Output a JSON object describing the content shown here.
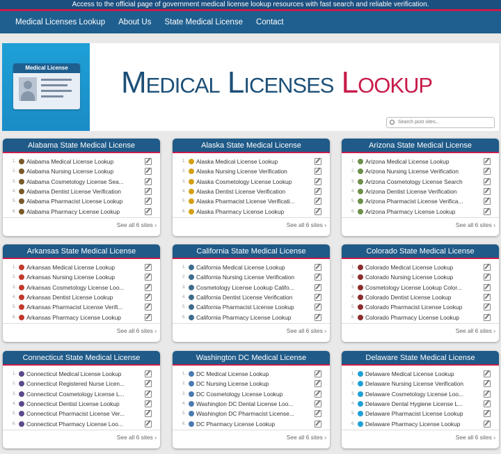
{
  "banner": {
    "text": "Access to the official page of government medical license lookup resources with fast search and reliable verification."
  },
  "nav": [
    "Medical Licenses Lookup",
    "About Us",
    "State Medical License",
    "Contact"
  ],
  "hero": {
    "card_label": "Medical License",
    "title_main": "Medical Licenses ",
    "title_accent": "Lookup",
    "search_placeholder": "Search post sites..."
  },
  "colors": {
    "brand": "#1e5f8f",
    "accent": "#c81b4a",
    "hero_blue": "#1ea0d6"
  },
  "panels": [
    {
      "title": "Alabama State Medical License",
      "icon": "#7a5a2a",
      "more": "See all 6 sites ›",
      "items": [
        "Alabama Medical License Lookup",
        "Alabama Nursing License Lookup",
        "Alabama Cosmetology License Sea...",
        "Alabama Dentist License Verification",
        "Alabama Pharmacist License Lookup",
        "Alabama Pharmacy License Lookup"
      ]
    },
    {
      "title": "Alaska State Medical License",
      "icon": "#d4a017",
      "more": "See all 6 sites ›",
      "items": [
        "Alaska Medical License Lookup",
        "Alaska Nursing License Verification",
        "Alaska Cosmetology License Lookup",
        "Alaska Dentist License Verification",
        "Alaska Pharmacist License Verificati...",
        "Alaska Pharmacy License Lookup"
      ]
    },
    {
      "title": "Arizona State Medical License",
      "icon": "#6d8f4a",
      "more": "See all 6 sites ›",
      "items": [
        "Arizona Medical License Lookup",
        "Arizona Nursing License Verification",
        "Arizona Cosmetology License Search",
        "Arizona Dentist License Verification",
        "Arizona Pharmacist License Verifica...",
        "Arizona Pharmacy License Lookup"
      ]
    },
    {
      "title": "Arkansas State Medical License",
      "icon": "#c0392b",
      "more": "See all 6 sites ›",
      "items": [
        "Arkansas Medical License Lookup",
        "Arkansas Nursing License Lookup",
        "Arkansas Cosmetology License Loo...",
        "Arkansas Dentist License Lookup",
        "Arkansas Pharmacist License Verifi...",
        "Arkansas Pharmacy License Lookup"
      ]
    },
    {
      "title": "California State Medical License",
      "icon": "#3d6b8c",
      "more": "See all 6 sites ›",
      "items": [
        "California Medical License Lookup",
        "California Nursing License Verification",
        "Cosmetology License Lookup Califo...",
        "California Dentist License Verification",
        "California Pharmacist License Lookup",
        "California Pharmacy License Lookup"
      ]
    },
    {
      "title": "Colorado State Medical License",
      "icon": "#8c2d2d",
      "more": "See all 6 sites ›",
      "items": [
        "Colorado Medical License Lookup",
        "Colorado Nursing License Lookup",
        "Cosmetology License Lookup Color...",
        "Colorado Dentist License Lookup",
        "Colorado Pharmacist License Lookup",
        "Colorado Pharmacy License Lookup"
      ]
    },
    {
      "title": "Connecticut State Medical License",
      "icon": "#5b4a8c",
      "more": "See all 6 sites ›",
      "items": [
        "Connecticut Medical License Lookup",
        "Connecticut Registered Nurse Licen...",
        "Connecticut Cosmetology License L...",
        "Connecticut Dentist License Lookup",
        "Connecticut Pharmacist License Ver...",
        "Connecticut Pharmacy License Loo..."
      ]
    },
    {
      "title": "Washington DC Medical License",
      "icon": "#4a7ab0",
      "more": "See all 6 sites ›",
      "items": [
        "DC Medical License Lookup",
        "DC Nursing License Lookup",
        "DC Cosmetology License Lookup",
        "Washington DC Dental License Loo...",
        "Washington DC Pharmacist License...",
        "DC Pharmacy License Lookup"
      ]
    },
    {
      "title": "Delaware State Medical License",
      "icon": "#1ea0d6",
      "more": "See all 6 sites ›",
      "items": [
        "Delaware Medical License Lookup",
        "Delaware Nursing License Verification",
        "Delaware Cosmetology License Loo...",
        "Delaware Dental Hygiene License L...",
        "Delaware Pharmacist License Lookup",
        "Delaware Pharmacy License Lookup"
      ]
    }
  ]
}
